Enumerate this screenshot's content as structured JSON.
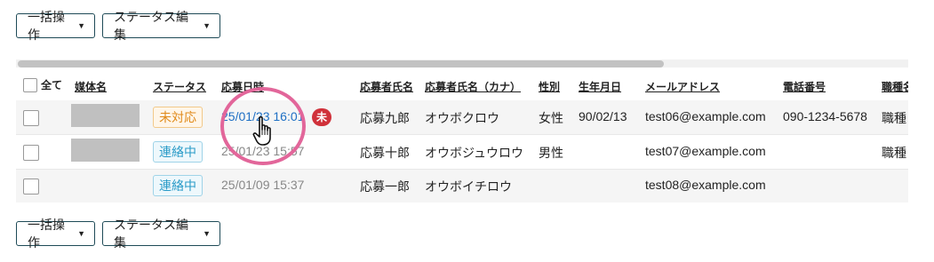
{
  "toolbar_top": {
    "bulk_label": "一括操作",
    "status_edit_label": "ステータス編集"
  },
  "toolbar_bottom": {
    "bulk_label": "一括操作",
    "status_edit_label": "ステータス編集"
  },
  "table": {
    "headers": [
      "全て",
      "媒体名",
      "ステータス",
      "応募日時",
      "応募者氏名",
      "応募者氏名（カナ）",
      "性別",
      "生年月日",
      "メールアドレス",
      "電話番号",
      "職種名"
    ],
    "rows": [
      {
        "status": "未対応",
        "status_color": "#e08a1a",
        "datetime": "25/01/23 16:01",
        "unread": "未",
        "name": "応募九郎",
        "kana": "オウボクロウ",
        "gender": "女性",
        "birth": "90/02/13",
        "email": "test06@example.com",
        "phone": "090-1234-5678",
        "job": "職種"
      },
      {
        "status": "連絡中",
        "status_color": "#2a9bc8",
        "datetime": "25/01/23 15:57",
        "name": "応募十郎",
        "kana": "オウボジュウロウ",
        "gender": "男性",
        "birth": "",
        "email": "test07@example.com",
        "phone": "",
        "job": "職種"
      },
      {
        "status": "連絡中",
        "status_color": "#2a9bc8",
        "datetime": "25/01/09 15:37",
        "name": "応募一郎",
        "kana": "オウボイチロウ",
        "gender": "",
        "birth": "",
        "email": "test08@example.com",
        "phone": "",
        "job": ""
      }
    ]
  },
  "colors": {
    "highlight": "#e2669a",
    "link": "#1e6fc4",
    "unread_badge": "#d0313a",
    "button_border": "#1e4a57"
  },
  "icons": {
    "cursor": "hand-pointer-icon",
    "dropdown": "caret-down-icon"
  }
}
